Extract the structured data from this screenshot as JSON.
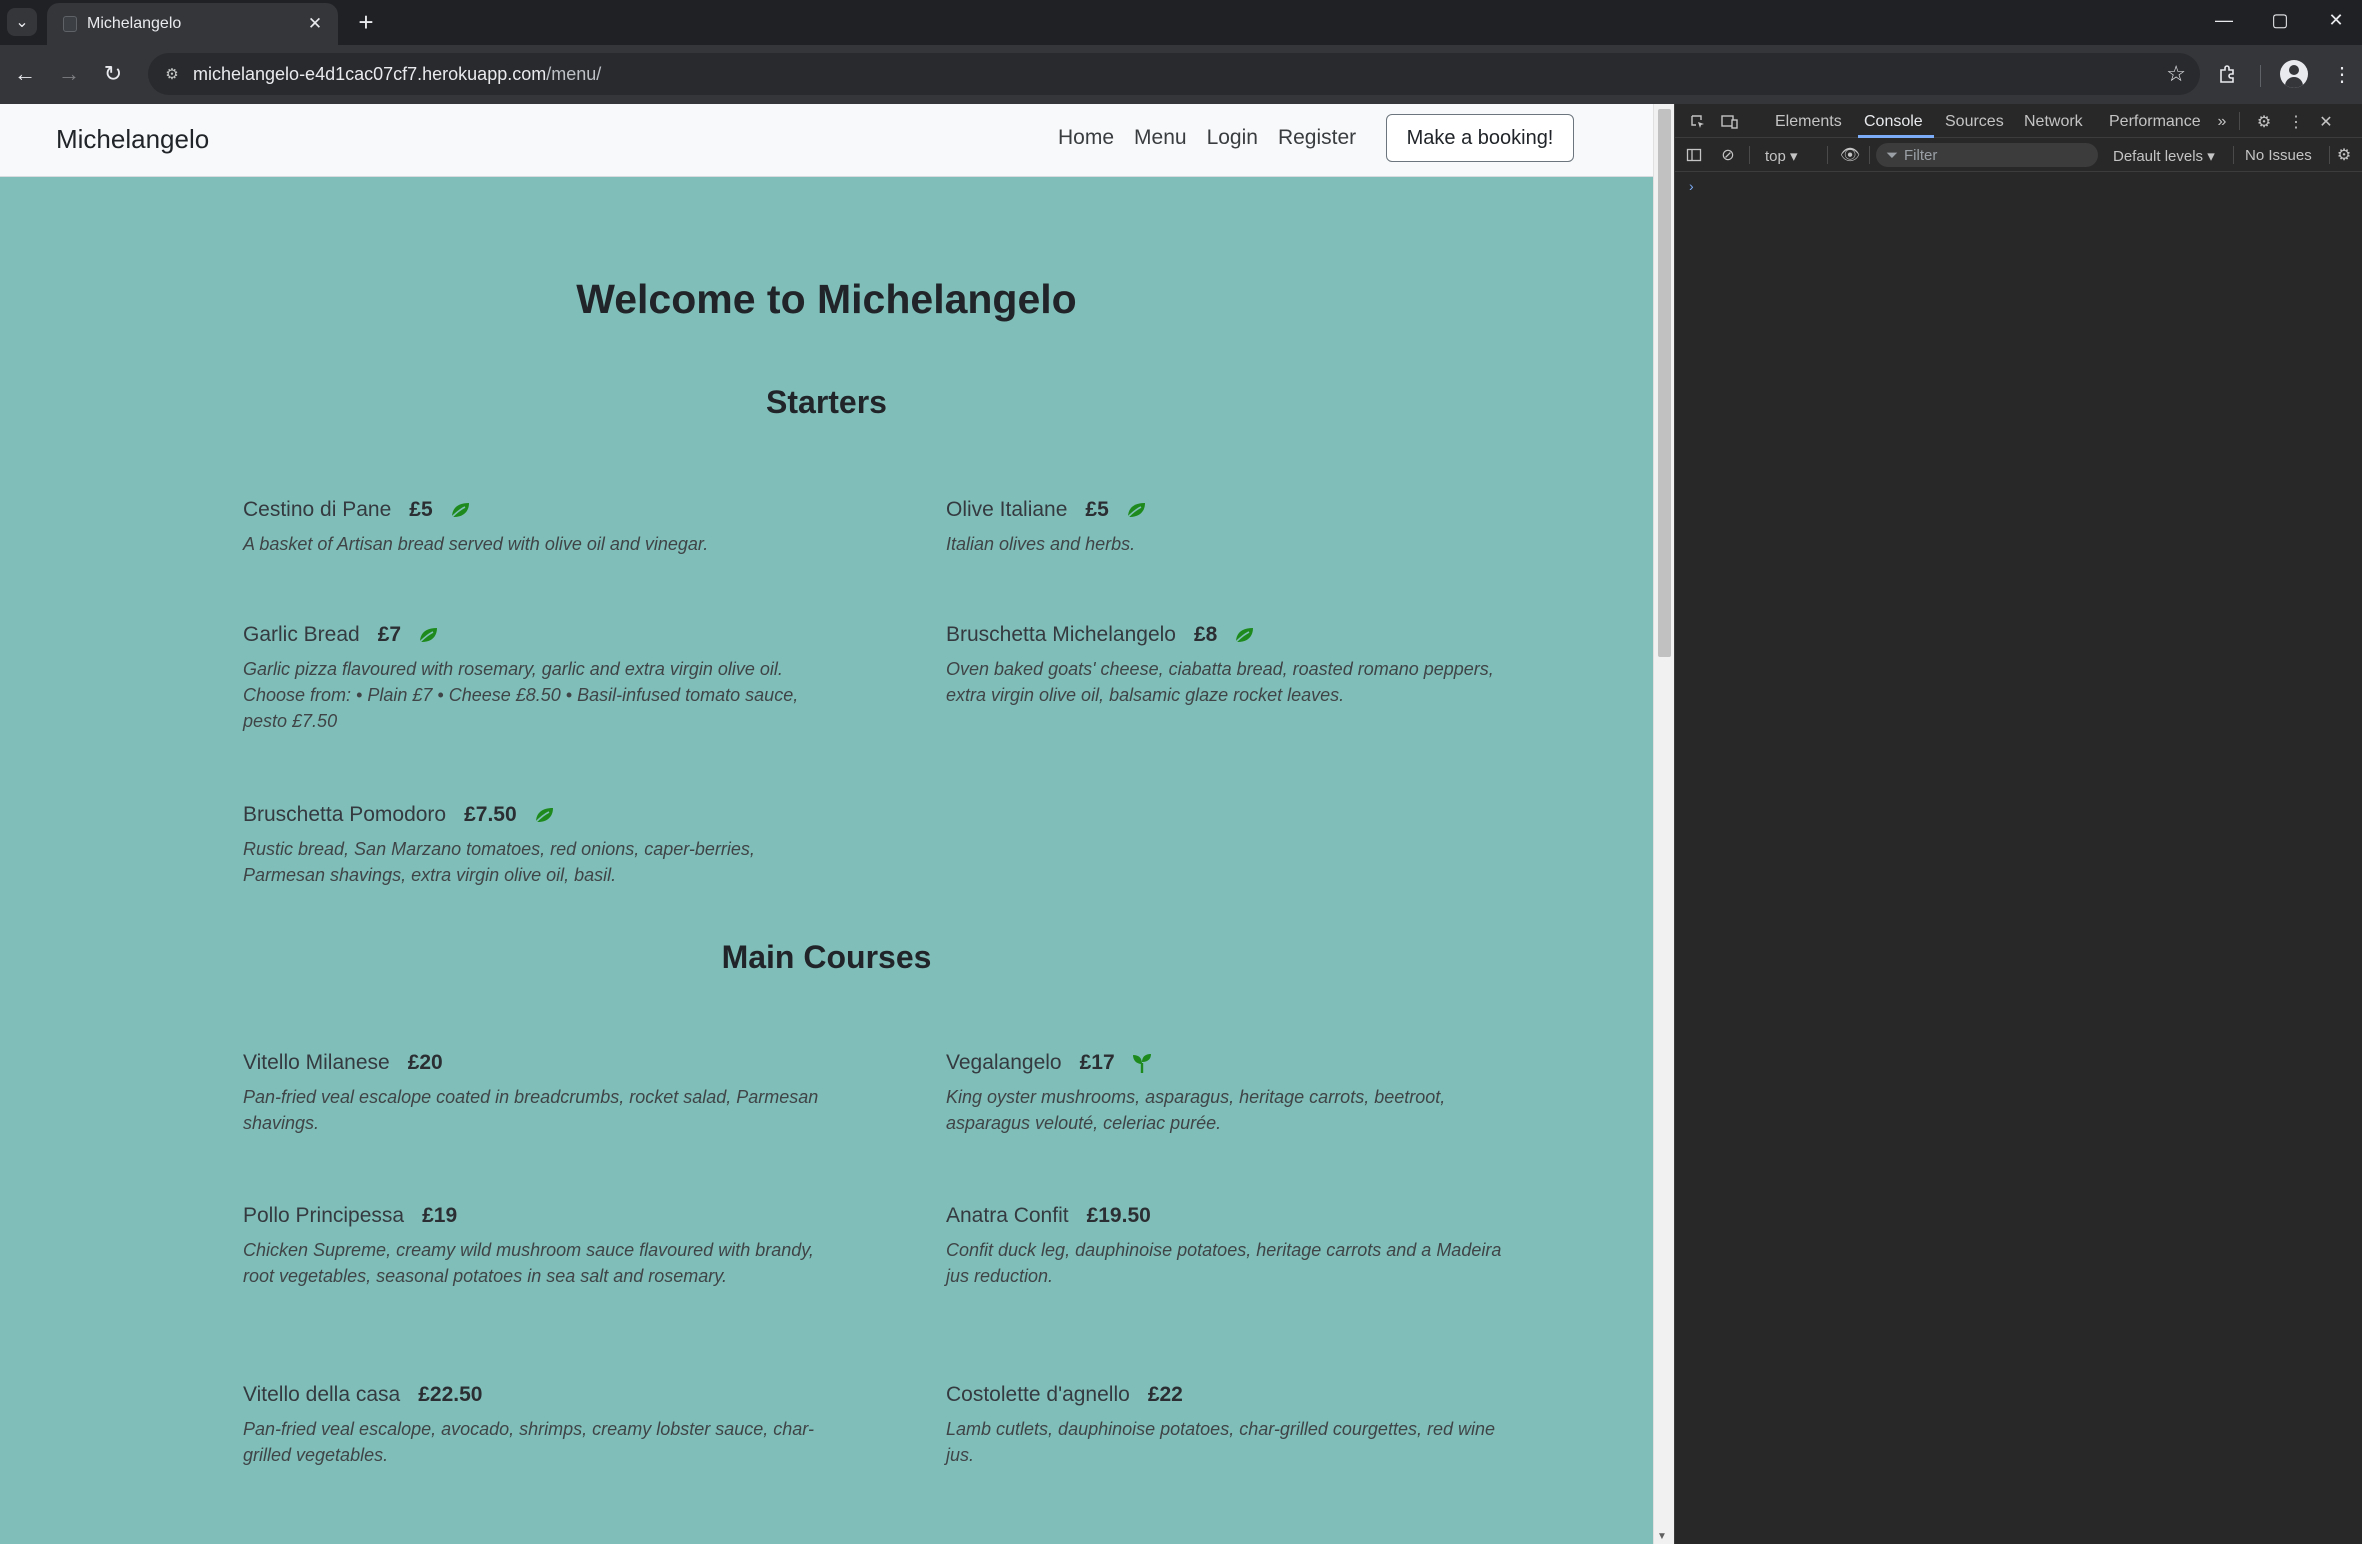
{
  "browser": {
    "tab_title": "Michelangelo",
    "url_host": "michelangelo-e4d1cac07cf7.herokuapp.com",
    "url_path": "/menu/"
  },
  "site": {
    "brand": "Michelangelo",
    "nav": [
      "Home",
      "Menu",
      "Login",
      "Register"
    ],
    "booking_button": "Make a booking!",
    "page_title": "Welcome to Michelangelo"
  },
  "sections": {
    "starters": "Starters",
    "mains": "Main Courses"
  },
  "starters": [
    {
      "name": "Cestino di Pane",
      "price": "£5",
      "icon": "leaf-icon",
      "desc": "A basket of Artisan bread served with olive oil and vinegar."
    },
    {
      "name": "Olive Italiane",
      "price": "£5",
      "icon": "leaf-icon",
      "desc": "Italian olives and herbs."
    },
    {
      "name": "Garlic Bread",
      "price": "£7",
      "icon": "leaf-icon",
      "desc": "Garlic pizza flavoured with rosemary, garlic and extra virgin olive oil. Choose from: • Plain £7 • Cheese £8.50 • Basil-infused tomato sauce, pesto £7.50"
    },
    {
      "name": "Bruschetta Michelangelo",
      "price": "£8",
      "icon": "leaf-icon",
      "desc": "Oven baked goats' cheese, ciabatta bread, roasted romano peppers, extra virgin olive oil, balsamic glaze rocket leaves."
    },
    {
      "name": "Bruschetta Pomodoro",
      "price": "£7.50",
      "icon": "leaf-icon",
      "desc": "Rustic bread, San Marzano tomatoes, red onions, caper-berries, Parmesan shavings, extra virgin olive oil, basil."
    }
  ],
  "mains": [
    {
      "name": "Vitello Milanese",
      "price": "£20",
      "icon": "",
      "desc": "Pan-fried veal escalope coated in breadcrumbs, rocket salad, Parmesan shavings."
    },
    {
      "name": "Vegalangelo",
      "price": "£17",
      "icon": "seedling-icon",
      "desc": "King oyster mushrooms, asparagus, heritage carrots, beetroot, asparagus velouté, celeriac purée."
    },
    {
      "name": "Pollo Principessa",
      "price": "£19",
      "icon": "",
      "desc": "Chicken Supreme, creamy wild mushroom sauce flavoured with brandy, root vegetables, seasonal potatoes in sea salt and rosemary."
    },
    {
      "name": "Anatra Confit",
      "price": "£19.50",
      "icon": "",
      "desc": "Confit duck leg, dauphinoise potatoes, heritage carrots and a Madeira jus reduction."
    },
    {
      "name": "Vitello della casa",
      "price": "£22.50",
      "icon": "",
      "desc": "Pan-fried veal escalope, avocado, shrimps, creamy lobster sauce, char-grilled vegetables."
    },
    {
      "name": "Costolette d'agnello",
      "price": "£22",
      "icon": "",
      "desc": "Lamb cutlets, dauphinoise potatoes, char-grilled courgettes, red wine jus."
    }
  ],
  "devtools": {
    "tabs": [
      "Elements",
      "Console",
      "Sources",
      "Network",
      "Performance"
    ],
    "active_tab": "Console",
    "context": "top",
    "filter_placeholder": "Filter",
    "levels": "Default levels",
    "issues": "No Issues"
  },
  "colors": {
    "page_background": "#80bfb9",
    "veg_icon": "#1e8a1e"
  }
}
